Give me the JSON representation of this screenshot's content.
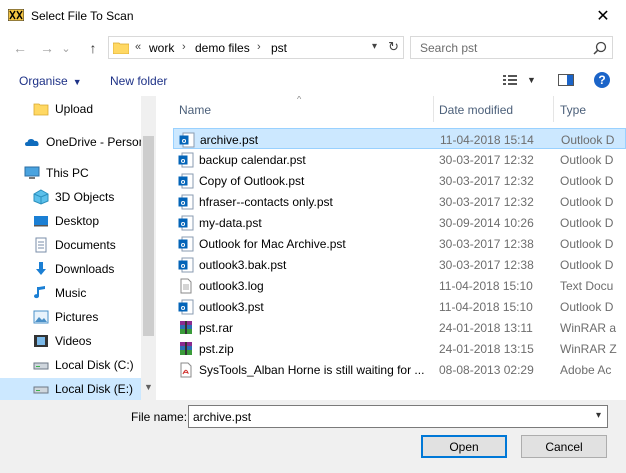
{
  "window": {
    "title": "Select File To Scan",
    "close_glyph": "✕"
  },
  "nav": {
    "back_glyph": "←",
    "forward_glyph": "→",
    "recent_glyph": "⌄",
    "up_glyph": "↑",
    "address": {
      "overflow": "«",
      "segments": [
        "work",
        "demo files",
        "pst"
      ],
      "separator": "›"
    },
    "search": {
      "placeholder": "Search pst"
    }
  },
  "toolbar": {
    "organise": "Organise",
    "new_folder": "New folder",
    "help": "?"
  },
  "sidebar": {
    "items": [
      {
        "label": "Upload",
        "icon": "folder-icon"
      },
      {
        "label": "OneDrive - Person",
        "icon": "onedrive-icon"
      },
      {
        "label": "This PC",
        "icon": "computer-icon"
      },
      {
        "label": "3D Objects",
        "icon": "3d-objects-icon"
      },
      {
        "label": "Desktop",
        "icon": "desktop-icon"
      },
      {
        "label": "Documents",
        "icon": "documents-icon"
      },
      {
        "label": "Downloads",
        "icon": "downloads-icon"
      },
      {
        "label": "Music",
        "icon": "music-icon"
      },
      {
        "label": "Pictures",
        "icon": "pictures-icon"
      },
      {
        "label": "Videos",
        "icon": "videos-icon"
      },
      {
        "label": "Local Disk (C:)",
        "icon": "drive-icon"
      },
      {
        "label": "Local Disk (E:)",
        "icon": "drive-icon"
      }
    ]
  },
  "columns": {
    "name": "Name",
    "date": "Date modified",
    "type": "Type"
  },
  "files": [
    {
      "name": "archive.pst",
      "date": "11-04-2018 15:14",
      "type": "Outlook D",
      "icon": "outlook-file-icon"
    },
    {
      "name": "backup calendar.pst",
      "date": "30-03-2017 12:32",
      "type": "Outlook D",
      "icon": "outlook-file-icon"
    },
    {
      "name": "Copy of Outlook.pst",
      "date": "30-03-2017 12:32",
      "type": "Outlook D",
      "icon": "outlook-file-icon"
    },
    {
      "name": "hfraser--contacts only.pst",
      "date": "30-03-2017 12:32",
      "type": "Outlook D",
      "icon": "outlook-file-icon"
    },
    {
      "name": "my-data.pst",
      "date": "30-09-2014 10:26",
      "type": "Outlook D",
      "icon": "outlook-file-icon"
    },
    {
      "name": "Outlook for Mac Archive.pst",
      "date": "30-03-2017 12:38",
      "type": "Outlook D",
      "icon": "outlook-file-icon"
    },
    {
      "name": "outlook3.bak.pst",
      "date": "30-03-2017 12:38",
      "type": "Outlook D",
      "icon": "outlook-file-icon"
    },
    {
      "name": "outlook3.log",
      "date": "11-04-2018 15:10",
      "type": "Text Docu",
      "icon": "text-file-icon"
    },
    {
      "name": "outlook3.pst",
      "date": "11-04-2018 15:10",
      "type": "Outlook D",
      "icon": "outlook-file-icon"
    },
    {
      "name": "pst.rar",
      "date": "24-01-2018 13:11",
      "type": "WinRAR a",
      "icon": "winrar-icon"
    },
    {
      "name": "pst.zip",
      "date": "24-01-2018 13:15",
      "type": "WinRAR Z",
      "icon": "winrar-icon"
    },
    {
      "name": "SysTools_Alban Horne is still waiting for ...",
      "date": "08-08-2013 02:29",
      "type": "Adobe Ac",
      "icon": "pdf-icon"
    }
  ],
  "bottom": {
    "file_name_label": "File name:",
    "file_name_value": "archive.pst",
    "open": "Open",
    "cancel": "Cancel"
  },
  "colors": {
    "selection": "#cce8ff",
    "accent": "#0078d7",
    "link": "#1e3287"
  }
}
